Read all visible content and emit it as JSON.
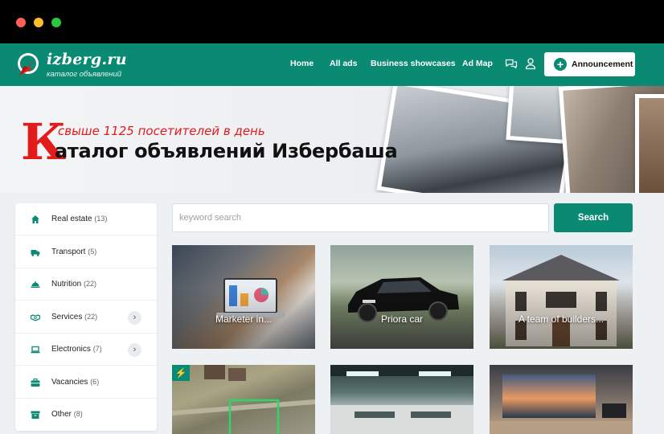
{
  "header": {
    "logo_title": "izberg.ru",
    "logo_subtitle": "каталог объявлений",
    "nav": [
      "Home",
      "All ads",
      "Business showcases",
      "Ad Map"
    ],
    "announcement_label": "Announcement",
    "icons": [
      "chat-icon",
      "user-icon",
      "plus-circle-icon"
    ]
  },
  "banner": {
    "initial": "К",
    "line1": "свыше 1125 посетителей в день",
    "line2": "аталог объявлений Избербаша"
  },
  "sidebar": {
    "items": [
      {
        "label": "Real estate",
        "count": "(13)",
        "icon": "home-icon",
        "has_arrow": false
      },
      {
        "label": "Transport",
        "count": "(5)",
        "icon": "truck-icon",
        "has_arrow": false
      },
      {
        "label": "Nutrition",
        "count": "(22)",
        "icon": "food-icon",
        "has_arrow": false
      },
      {
        "label": "Services",
        "count": "(22)",
        "icon": "handshake-icon",
        "has_arrow": true
      },
      {
        "label": "Electronics",
        "count": "(7)",
        "icon": "laptop-icon",
        "has_arrow": true
      },
      {
        "label": "Vacancies",
        "count": "(6)",
        "icon": "briefcase-icon",
        "has_arrow": false
      },
      {
        "label": "Other",
        "count": "(8)",
        "icon": "box-icon",
        "has_arrow": false
      }
    ]
  },
  "search": {
    "placeholder": "keyword search",
    "value": "",
    "button_label": "Search"
  },
  "listings": [
    {
      "title": "Marketer in...",
      "image": "laptop-analytics-photo"
    },
    {
      "title": "Priora car",
      "image": "black-sedan-photo"
    },
    {
      "title": "A team of builders...",
      "image": "mansion-photo"
    },
    {
      "title": "",
      "image": "aerial-plot-photo",
      "badge": "lightning-icon"
    },
    {
      "title": "",
      "image": "office-interior-photo"
    },
    {
      "title": "",
      "image": "living-room-photo"
    }
  ],
  "colors": {
    "brand": "#0a8a73",
    "accent_red": "#e21b1b"
  }
}
